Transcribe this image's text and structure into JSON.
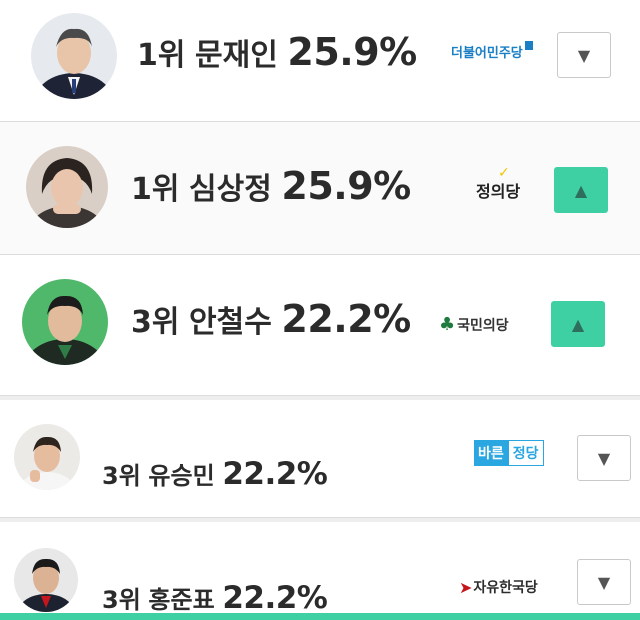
{
  "candidates": [
    {
      "rank": "1위",
      "name": "문재인",
      "percent": "25.9%",
      "party": "더불어민주당",
      "party_color": "#1a7fc4",
      "arrow": "▼",
      "vote_state": "down"
    },
    {
      "rank": "1위",
      "name": "심상정",
      "percent": "25.9%",
      "party": "정의당",
      "party_color": "#222222",
      "accent_color": "#f4c600",
      "arrow": "▲",
      "vote_state": "up"
    },
    {
      "rank": "3위",
      "name": "안철수",
      "percent": "22.2%",
      "party": "국민의당",
      "party_color": "#1f7a3e",
      "arrow": "▲",
      "vote_state": "up"
    },
    {
      "rank": "3위",
      "name": "유승민",
      "percent": "22.2%",
      "party_a": "바른",
      "party_b": "정당",
      "party_color": "#2aa7e0",
      "arrow": "▼",
      "vote_state": "down"
    },
    {
      "rank": "3위",
      "name": "홍준표",
      "percent": "22.2%",
      "party": "자유한국당",
      "party_color": "#c4161c",
      "arrow": "▼",
      "vote_state": "down"
    }
  ],
  "colors": {
    "accent": "#3ecfa3",
    "up_button": "#3ecfa3",
    "down_button_border": "#c9c9c9"
  },
  "icons": {
    "down": "triangle-down-icon",
    "up": "triangle-up-icon"
  }
}
